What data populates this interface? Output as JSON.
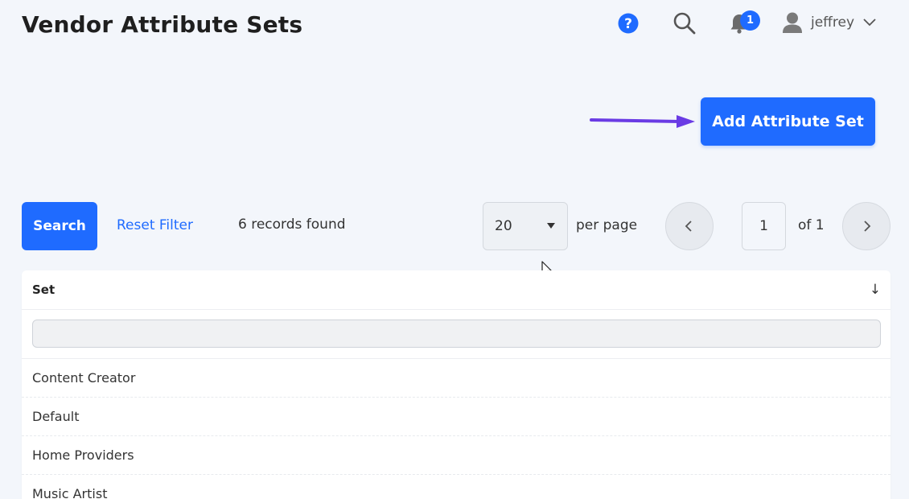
{
  "header": {
    "title": "Vendor Attribute Sets",
    "notification_count": "1",
    "username": "jeffrey",
    "icons": [
      "help-icon",
      "search-icon",
      "bell-icon",
      "user-icon",
      "chevron-down-icon"
    ]
  },
  "actions": {
    "add_label": "Add Attribute Set"
  },
  "toolbar": {
    "search_label": "Search",
    "reset_label": "Reset Filter",
    "records_found": "6 records found",
    "per_page_value": "20",
    "per_page_label": "per page",
    "page_value": "1",
    "of_pages": "of 1"
  },
  "table": {
    "column_header": "Set",
    "sort_indicator": "↓",
    "rows": [
      "Content Creator",
      "Default",
      "Home Providers",
      "Music Artist"
    ]
  },
  "colors": {
    "accent": "#1f6bff",
    "background": "#f3f6fb",
    "annotation_arrow": "#6a3be4"
  }
}
